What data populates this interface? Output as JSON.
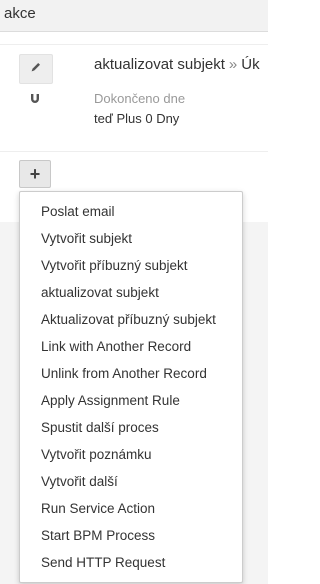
{
  "header": {
    "title": "akce"
  },
  "action": {
    "name": "aktualizovat subjekt",
    "separator": "»",
    "target": "Úk",
    "done_label": "Dokončeno dne",
    "done_value": "teď Plus 0 Dny",
    "edit_icon": "pencil-icon",
    "type_icon": "magnet-icon"
  },
  "add_button": {
    "label": "+"
  },
  "menu": {
    "items": [
      {
        "label": "Poslat email"
      },
      {
        "label": "Vytvořit subjekt"
      },
      {
        "label": "Vytvořit příbuzný subjekt"
      },
      {
        "label": "aktualizovat subjekt"
      },
      {
        "label": "Aktualizovat příbuzný subjekt"
      },
      {
        "label": "Link with Another Record"
      },
      {
        "label": "Unlink from Another Record"
      },
      {
        "label": "Apply Assignment Rule"
      },
      {
        "label": "Spustit další proces"
      },
      {
        "label": "Vytvořit poznámku"
      },
      {
        "label": "Vytvořit další"
      },
      {
        "label": "Run Service Action"
      },
      {
        "label": "Start BPM Process"
      },
      {
        "label": "Send HTTP Request"
      }
    ]
  }
}
